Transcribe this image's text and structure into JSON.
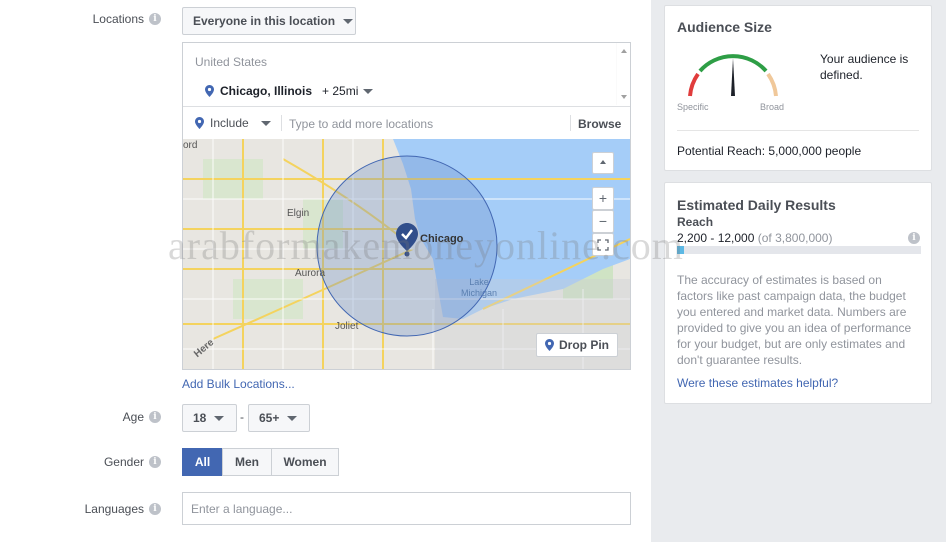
{
  "locations": {
    "label": "Locations",
    "dropdown_value": "Everyone in this location",
    "country": "United States",
    "city": "Chicago, Illinois",
    "radius": "+ 25mi",
    "include_label": "Include",
    "input_placeholder": "Type to add more locations",
    "browse_label": "Browse",
    "map": {
      "city_labels": [
        "Chicago",
        "Elgin",
        "Aurora",
        "Joliet",
        "Lake Michigan",
        "ord"
      ],
      "drop_pin_label": "Drop Pin",
      "zoom_in": "+",
      "zoom_out": "−",
      "logo_text": "Here"
    },
    "bulk_link": "Add Bulk Locations..."
  },
  "age": {
    "label": "Age",
    "min": "18",
    "max": "65+",
    "separator": "-"
  },
  "gender": {
    "label": "Gender",
    "options": [
      "All",
      "Men",
      "Women"
    ],
    "selected": "All"
  },
  "languages": {
    "label": "Languages",
    "placeholder": "Enter a language..."
  },
  "audience_size": {
    "title": "Audience Size",
    "status_text": "Your audience is defined.",
    "specific_label": "Specific",
    "broad_label": "Broad",
    "potential_reach": "Potential Reach: 5,000,000 people"
  },
  "daily_results": {
    "title": "Estimated Daily Results",
    "reach_label": "Reach",
    "reach_range": "2,200 - 12,000",
    "reach_of": "(of 3,800,000)",
    "reach_fraction": 0.03,
    "disclaimer": "The accuracy of estimates is based on factors like past campaign data, the budget you entered and market data. Numbers are provided to give you an idea of performance for your budget, but are only estimates and don't guarantee results.",
    "feedback_link": "Were these estimates helpful?"
  },
  "watermark": "arabformakemoneyonline.com",
  "colors": {
    "accent": "#4267b2",
    "gauge_red": "#e03c3c",
    "gauge_green": "#2e9e46",
    "gauge_tan": "#f0c89a",
    "water": "#a5cdf8"
  }
}
